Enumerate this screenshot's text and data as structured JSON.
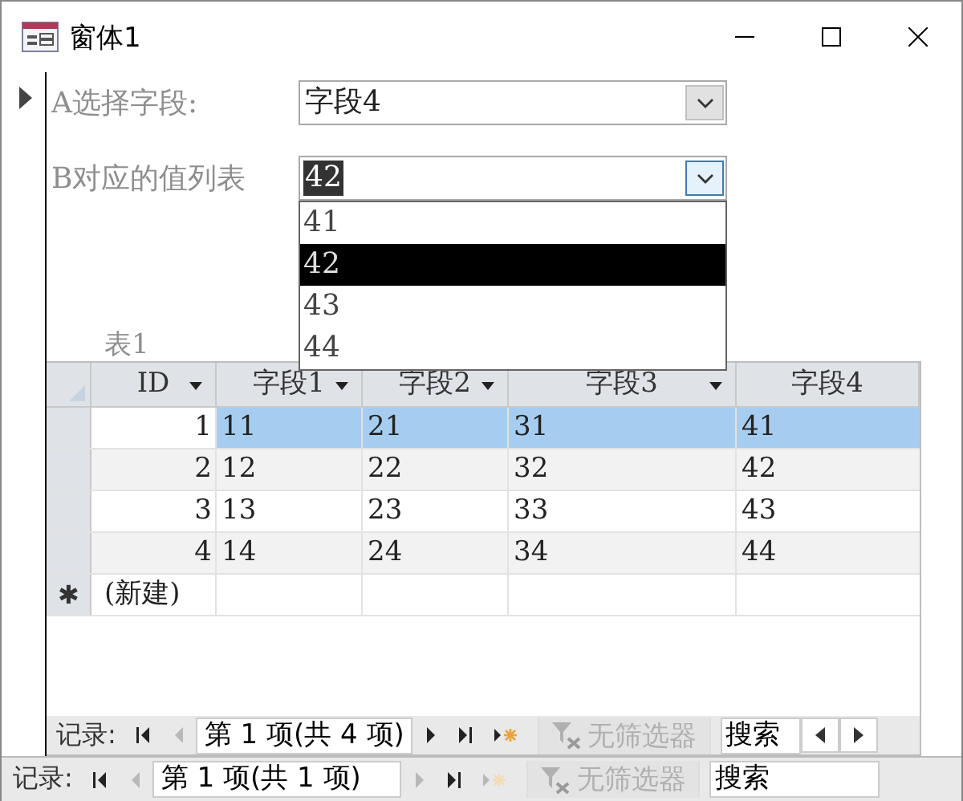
{
  "window": {
    "title": "窗体1"
  },
  "form": {
    "fields": [
      {
        "label": "A选择字段:",
        "value": "字段4",
        "focused": false,
        "value_selected": false
      },
      {
        "label": "B对应的值列表",
        "value": "42",
        "focused": true,
        "value_selected": true
      }
    ],
    "dropdown": {
      "items": [
        {
          "text": "41",
          "selected": false
        },
        {
          "text": "42",
          "selected": true
        },
        {
          "text": "43",
          "selected": false
        },
        {
          "text": "44",
          "selected": false
        }
      ]
    },
    "subform": {
      "label": "表1",
      "columns": [
        {
          "label": "ID",
          "filter": true
        },
        {
          "label": "字段1",
          "filter": true
        },
        {
          "label": "字段2",
          "filter": true
        },
        {
          "label": "字段3",
          "filter": true
        },
        {
          "label": "字段4",
          "filter": false
        }
      ],
      "rows": [
        {
          "cells": [
            "1",
            "11",
            "21",
            "31",
            "41"
          ],
          "selected": true
        },
        {
          "cells": [
            "2",
            "12",
            "22",
            "32",
            "42"
          ],
          "selected": false
        },
        {
          "cells": [
            "3",
            "13",
            "23",
            "33",
            "43"
          ],
          "selected": false
        },
        {
          "cells": [
            "4",
            "14",
            "24",
            "34",
            "44"
          ],
          "selected": false
        }
      ],
      "new_row": {
        "marker": "✱",
        "label": "(新建)"
      },
      "navigation": {
        "label": "记录:",
        "position": "第 1 项(共 4 项)",
        "filter": "无筛选器",
        "search": "搜索",
        "hscroll": true,
        "buttons": [
          {
            "kind": "first",
            "disabled": false
          },
          {
            "kind": "prev",
            "disabled": true
          }
        ],
        "buttons_after": [
          {
            "kind": "next",
            "disabled": false
          },
          {
            "kind": "last",
            "disabled": false
          },
          {
            "kind": "new",
            "disabled": false
          }
        ]
      }
    },
    "navigation": {
      "label": "记录:",
      "position": "第 1 项(共 1 项)",
      "filter": "无筛选器",
      "search": "搜索",
      "hscroll": false,
      "buttons": [
        {
          "kind": "first",
          "disabled": false
        },
        {
          "kind": "prev",
          "disabled": true
        }
      ],
      "buttons_after": [
        {
          "kind": "next",
          "disabled": true
        },
        {
          "kind": "last",
          "disabled": false
        },
        {
          "kind": "new",
          "disabled": true
        }
      ]
    }
  }
}
